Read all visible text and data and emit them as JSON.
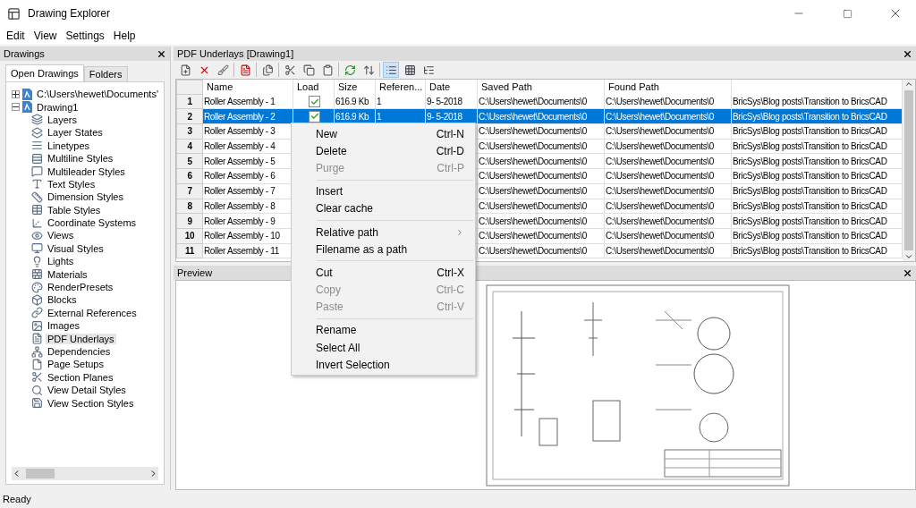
{
  "window": {
    "title": "Drawing Explorer"
  },
  "menu_bar": [
    "Edit",
    "View",
    "Settings",
    "Help"
  ],
  "drawings_panel": {
    "title": "Drawings",
    "tabs": [
      {
        "label": "Open Drawings",
        "selected": true
      },
      {
        "label": "Folders",
        "selected": false
      }
    ],
    "tree": [
      {
        "label": "C:\\Users\\hewet\\Documents'",
        "expanded": false,
        "selected": false
      },
      {
        "label": "Drawing1",
        "expanded": true,
        "selected": false,
        "children": [
          {
            "label": "Layers",
            "selected": false
          },
          {
            "label": "Layer States",
            "selected": false
          },
          {
            "label": "Linetypes",
            "selected": false
          },
          {
            "label": "Multiline Styles",
            "selected": false
          },
          {
            "label": "Multileader Styles",
            "selected": false
          },
          {
            "label": "Text Styles",
            "selected": false
          },
          {
            "label": "Dimension Styles",
            "selected": false
          },
          {
            "label": "Table Styles",
            "selected": false
          },
          {
            "label": "Coordinate Systems",
            "selected": false
          },
          {
            "label": "Views",
            "selected": false
          },
          {
            "label": "Visual Styles",
            "selected": false
          },
          {
            "label": "Lights",
            "selected": false
          },
          {
            "label": "Materials",
            "selected": false
          },
          {
            "label": "RenderPresets",
            "selected": false
          },
          {
            "label": "Blocks",
            "selected": false
          },
          {
            "label": "External References",
            "selected": false
          },
          {
            "label": "Images",
            "selected": false
          },
          {
            "label": "PDF Underlays",
            "selected": true
          },
          {
            "label": "Dependencies",
            "selected": false
          },
          {
            "label": "Page Setups",
            "selected": false
          },
          {
            "label": "Section Planes",
            "selected": false
          },
          {
            "label": "View Detail Styles",
            "selected": false
          },
          {
            "label": "View Section Styles",
            "selected": false
          }
        ]
      }
    ]
  },
  "underlays_panel": {
    "title": "PDF Underlays [Drawing1]",
    "view_buttons": [
      {
        "selected": true
      },
      {
        "selected": false
      },
      {
        "selected": false
      }
    ],
    "table": {
      "columns": [
        "Name",
        "Load",
        "Size",
        "Referen...",
        "Date",
        "Saved Path",
        "Found Path"
      ],
      "rows": [
        {
          "number": "1",
          "name": "Roller Assembly - 1",
          "load": true,
          "size": "616.9 Kb",
          "references": "1",
          "date": "9- 5-2018",
          "saved_path": "C:\\Users\\hewet\\Documents\\0",
          "found_path": "C:\\Users\\hewet\\Documents\\0",
          "column_8": "BricSys\\Blog posts\\Transition to BricsCAD",
          "selected": false
        },
        {
          "number": "2",
          "name": "Roller Assembly - 2",
          "load": true,
          "size": "616.9 Kb",
          "references": "1",
          "date": "9- 5-2018",
          "saved_path": "C:\\Users\\hewet\\Documents\\0",
          "found_path": "C:\\Users\\hewet\\Documents\\0",
          "column_8": "BricSys\\Blog posts\\Transition to BricsCAD",
          "selected": true
        },
        {
          "number": "3",
          "name": "Roller Assembly - 3",
          "saved_path": "C:\\Users\\hewet\\Documents\\0",
          "found_path": "C:\\Users\\hewet\\Documents\\0",
          "column_8": "BricSys\\Blog posts\\Transition to BricsCAD",
          "selected": false
        },
        {
          "number": "4",
          "name": "Roller Assembly - 4",
          "saved_path": "C:\\Users\\hewet\\Documents\\0",
          "found_path": "C:\\Users\\hewet\\Documents\\0",
          "column_8": "BricSys\\Blog posts\\Transition to BricsCAD",
          "selected": false
        },
        {
          "number": "5",
          "name": "Roller Assembly - 5",
          "saved_path": "C:\\Users\\hewet\\Documents\\0",
          "found_path": "C:\\Users\\hewet\\Documents\\0",
          "column_8": "BricSys\\Blog posts\\Transition to BricsCAD",
          "selected": false
        },
        {
          "number": "6",
          "name": "Roller Assembly - 6",
          "saved_path": "C:\\Users\\hewet\\Documents\\0",
          "found_path": "C:\\Users\\hewet\\Documents\\0",
          "column_8": "BricSys\\Blog posts\\Transition to BricsCAD",
          "selected": false
        },
        {
          "number": "7",
          "name": "Roller Assembly - 7",
          "saved_path": "C:\\Users\\hewet\\Documents\\0",
          "found_path": "C:\\Users\\hewet\\Documents\\0",
          "column_8": "BricSys\\Blog posts\\Transition to BricsCAD",
          "selected": false
        },
        {
          "number": "8",
          "name": "Roller Assembly - 8",
          "saved_path": "C:\\Users\\hewet\\Documents\\0",
          "found_path": "C:\\Users\\hewet\\Documents\\0",
          "column_8": "BricSys\\Blog posts\\Transition to BricsCAD",
          "selected": false
        },
        {
          "number": "9",
          "name": "Roller Assembly - 9",
          "saved_path": "C:\\Users\\hewet\\Documents\\0",
          "found_path": "C:\\Users\\hewet\\Documents\\0",
          "column_8": "BricSys\\Blog posts\\Transition to BricsCAD",
          "selected": false
        },
        {
          "number": "10",
          "name": "Roller Assembly - 10",
          "saved_path": "C:\\Users\\hewet\\Documents\\0",
          "found_path": "C:\\Users\\hewet\\Documents\\0",
          "column_8": "BricSys\\Blog posts\\Transition to BricsCAD",
          "selected": false
        },
        {
          "number": "11",
          "name": "Roller Assembly - 11",
          "saved_path": "C:\\Users\\hewet\\Documents\\0",
          "found_path": "C:\\Users\\hewet\\Documents\\0",
          "column_8": "BricSys\\Blog posts\\Transition to BricsCAD",
          "selected": false
        }
      ]
    }
  },
  "context_menu": {
    "groups": [
      [
        {
          "label": "New",
          "shortcut": "Ctrl-N",
          "disabled": false
        },
        {
          "label": "Delete",
          "shortcut": "Ctrl-D",
          "disabled": false
        },
        {
          "label": "Purge",
          "shortcut": "Ctrl-P",
          "disabled": true
        }
      ],
      [
        {
          "label": "Insert",
          "disabled": false
        },
        {
          "label": "Clear cache",
          "disabled": false
        }
      ],
      [
        {
          "label": "Relative path",
          "disabled": false,
          "submenu": true
        },
        {
          "label": "Filename as a path",
          "disabled": false
        }
      ],
      [
        {
          "label": "Cut",
          "shortcut": "Ctrl-X",
          "disabled": false
        },
        {
          "label": "Copy",
          "shortcut": "Ctrl-C",
          "disabled": true
        },
        {
          "label": "Paste",
          "shortcut": "Ctrl-V",
          "disabled": true
        }
      ],
      [
        {
          "label": "Rename",
          "disabled": false
        },
        {
          "label": "Select All",
          "disabled": false
        },
        {
          "label": "Invert Selection",
          "disabled": false
        }
      ]
    ]
  },
  "preview_panel": {
    "title": "Preview"
  },
  "status_bar": {
    "text": "Ready"
  }
}
